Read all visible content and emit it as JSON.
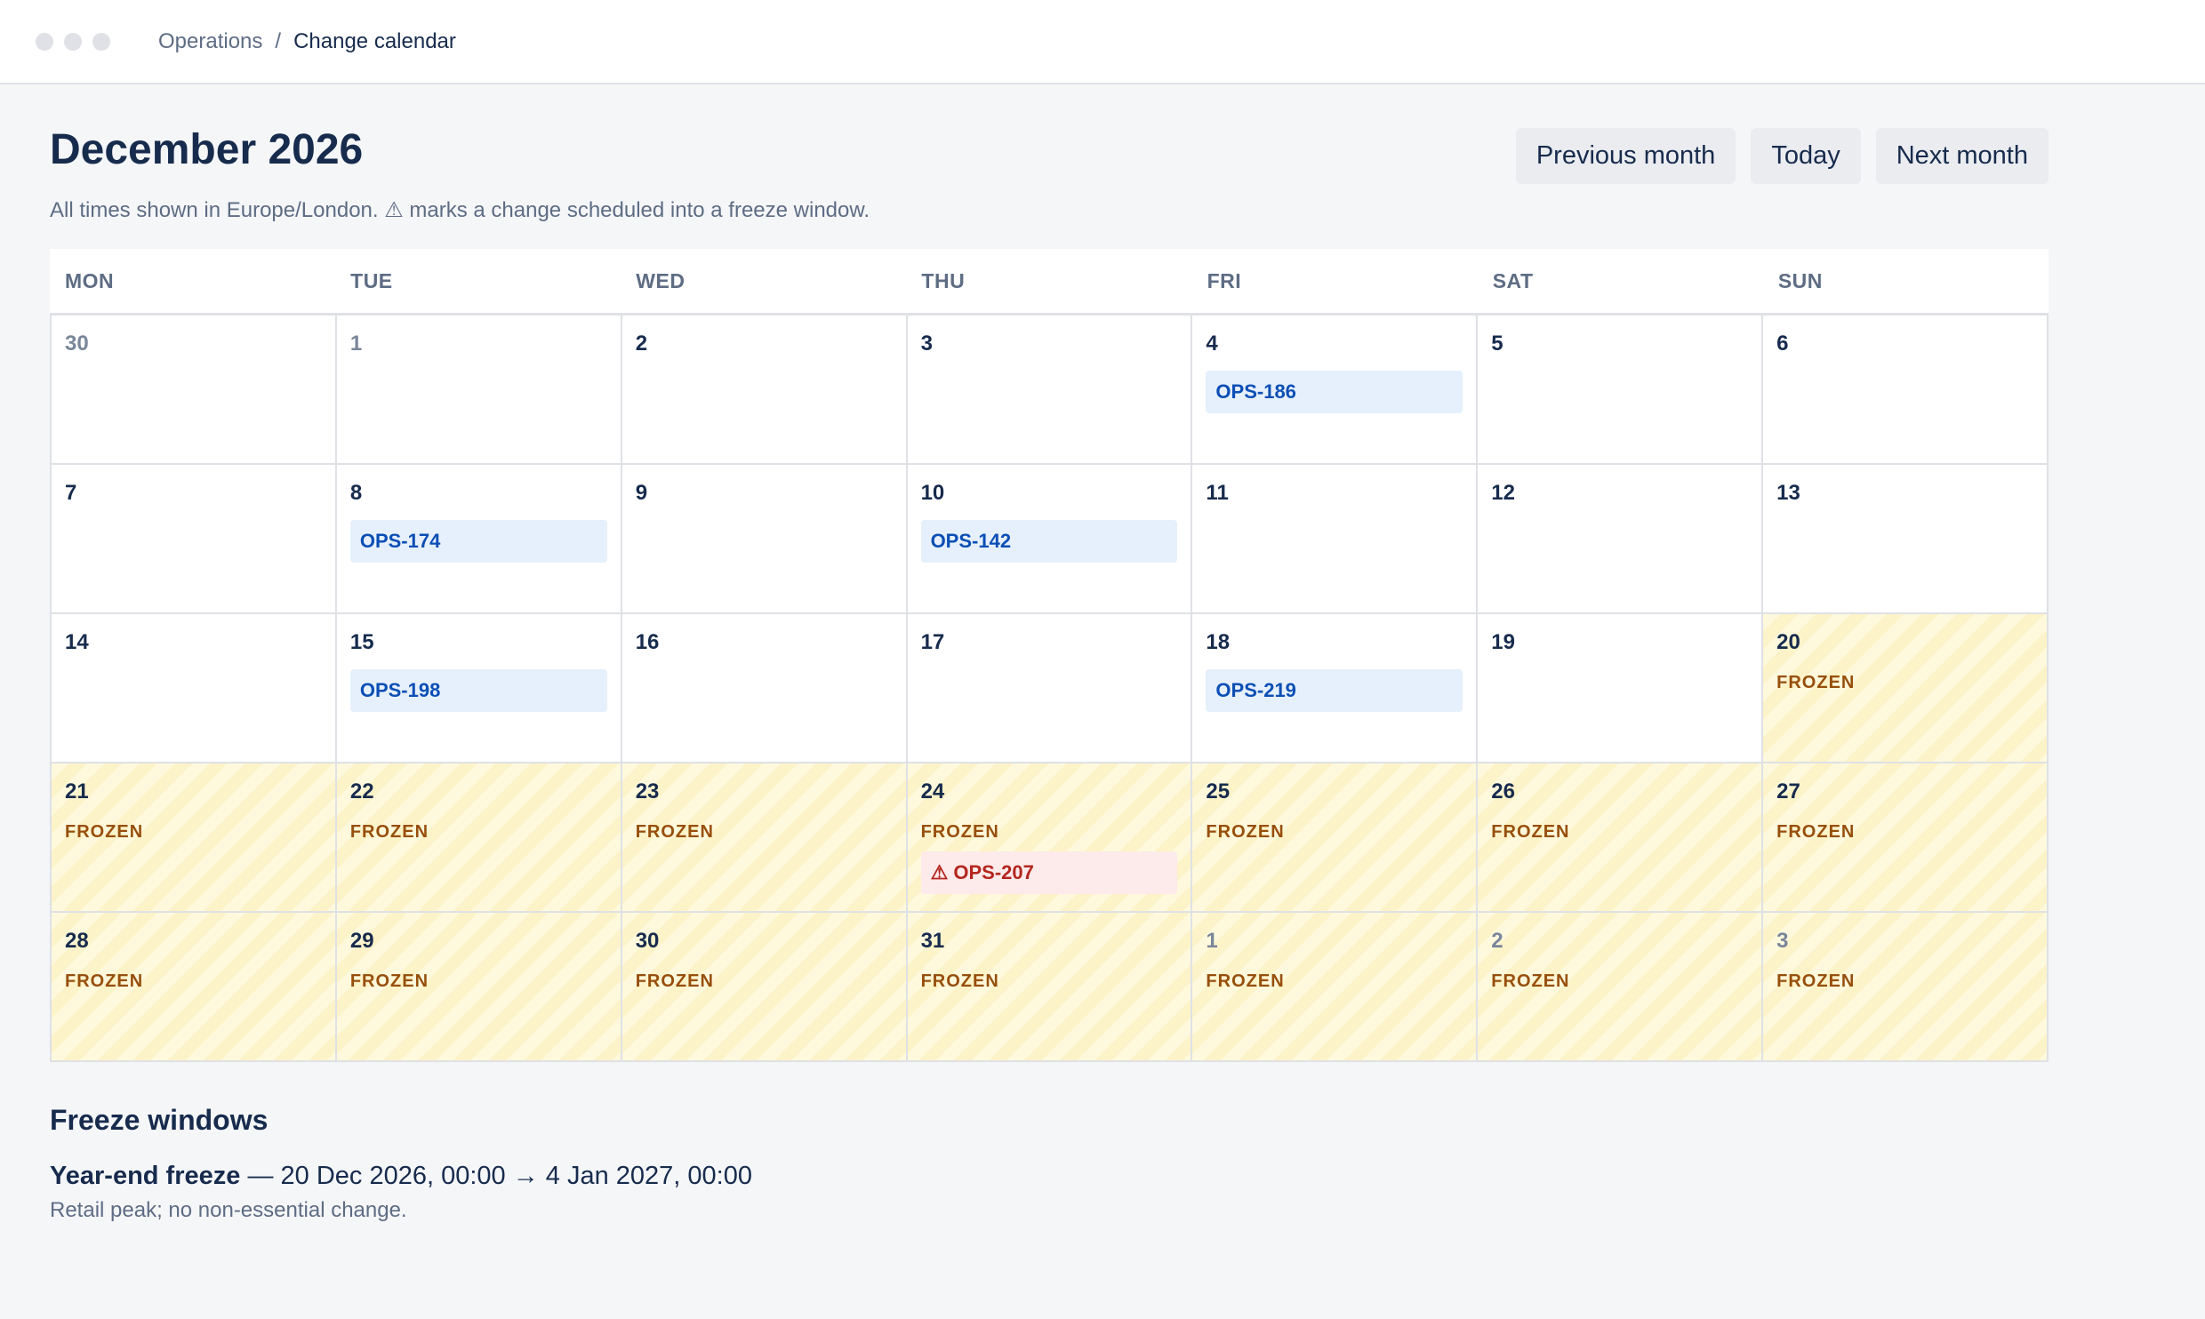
{
  "breadcrumb": {
    "parent": "Operations",
    "separator": "/",
    "current": "Change calendar"
  },
  "header": {
    "title": "December 2026",
    "subtitle": "All times shown in Europe/London. ⚠ marks a change scheduled into a freeze window."
  },
  "nav": {
    "previous": "Previous month",
    "today": "Today",
    "next": "Next month"
  },
  "weekdays": [
    "MON",
    "TUE",
    "WED",
    "THU",
    "FRI",
    "SAT",
    "SUN"
  ],
  "frozen_label": "FROZEN",
  "weeks": [
    [
      {
        "day": "30",
        "other": true
      },
      {
        "day": "1",
        "other": true
      },
      {
        "day": "2"
      },
      {
        "day": "3"
      },
      {
        "day": "4",
        "chips": [
          {
            "label": "OPS-186"
          }
        ]
      },
      {
        "day": "5"
      },
      {
        "day": "6"
      }
    ],
    [
      {
        "day": "7"
      },
      {
        "day": "8",
        "chips": [
          {
            "label": "OPS-174"
          }
        ]
      },
      {
        "day": "9"
      },
      {
        "day": "10",
        "chips": [
          {
            "label": "OPS-142"
          }
        ]
      },
      {
        "day": "11"
      },
      {
        "day": "12"
      },
      {
        "day": "13"
      }
    ],
    [
      {
        "day": "14"
      },
      {
        "day": "15",
        "chips": [
          {
            "label": "OPS-198"
          }
        ]
      },
      {
        "day": "16"
      },
      {
        "day": "17"
      },
      {
        "day": "18",
        "chips": [
          {
            "label": "OPS-219"
          }
        ]
      },
      {
        "day": "19"
      },
      {
        "day": "20",
        "frozen": true
      }
    ],
    [
      {
        "day": "21",
        "frozen": true
      },
      {
        "day": "22",
        "frozen": true
      },
      {
        "day": "23",
        "frozen": true
      },
      {
        "day": "24",
        "frozen": true,
        "chips": [
          {
            "label": "⚠ OPS-207",
            "warning": true
          }
        ]
      },
      {
        "day": "25",
        "frozen": true
      },
      {
        "day": "26",
        "frozen": true
      },
      {
        "day": "27",
        "frozen": true
      }
    ],
    [
      {
        "day": "28",
        "frozen": true
      },
      {
        "day": "29",
        "frozen": true
      },
      {
        "day": "30",
        "frozen": true
      },
      {
        "day": "31",
        "frozen": true
      },
      {
        "day": "1",
        "frozen": true,
        "other": true
      },
      {
        "day": "2",
        "frozen": true,
        "other": true
      },
      {
        "day": "3",
        "frozen": true,
        "other": true
      }
    ]
  ],
  "freeze_windows": {
    "heading": "Freeze windows",
    "items": [
      {
        "name": "Year-end freeze",
        "range": " — 20 Dec 2026, 00:00 → 4 Jan 2027, 00:00",
        "note": "Retail peak; no non-essential change."
      }
    ]
  },
  "colors": {
    "frozen_text": "#974f0c",
    "chip_bg": "#e6f0fc",
    "chip_text": "#0b4fb5",
    "warning_bg": "#fdeaea",
    "warning_text": "#b3261e"
  }
}
